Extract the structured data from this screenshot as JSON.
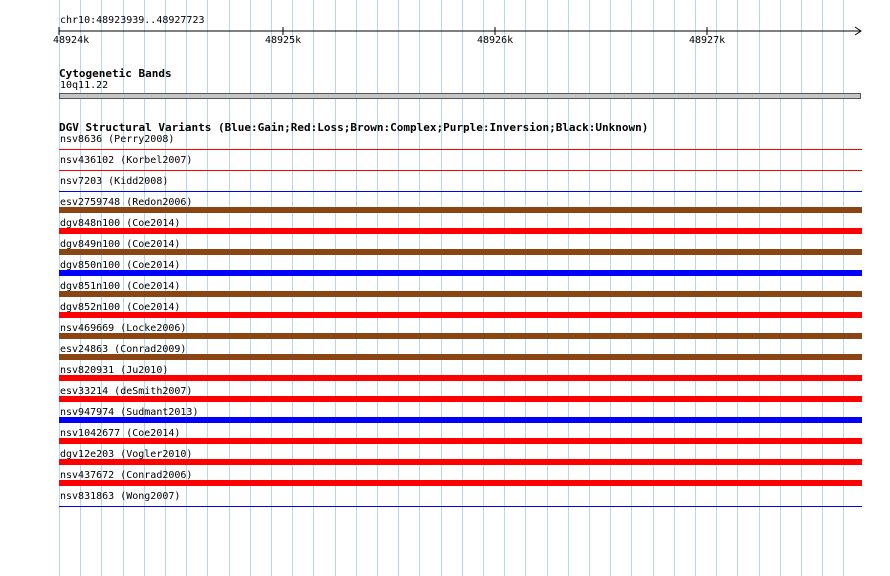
{
  "locus": "chr10:48923939..48927723",
  "ruler": {
    "ticks": [
      "48924k",
      "48925k",
      "48926k",
      "48927k"
    ]
  },
  "cytoband": {
    "title": "Cytogenetic Bands",
    "band": "10q11.22",
    "color": "#c4c4c4"
  },
  "dgv": {
    "title": "DGV Structural Variants (Blue:Gain;Red:Loss;Brown:Complex;Purple:Inversion;Black:Unknown)",
    "colors": {
      "gain": "#0000ff",
      "loss": "#ff0000",
      "complex": "#8b4513",
      "inversion": "#800080",
      "unknown": "#000000"
    },
    "items": [
      {
        "label": "nsv8636 (Perry2008)",
        "type": "loss",
        "weight": "thin"
      },
      {
        "label": "nsv436102 (Korbel2007)",
        "type": "loss",
        "weight": "thin"
      },
      {
        "label": "nsv7203 (Kidd2008)",
        "type": "gain",
        "weight": "thin"
      },
      {
        "label": "esv2759748 (Redon2006)",
        "type": "complex",
        "weight": "thick"
      },
      {
        "label": "dgv848n100 (Coe2014)",
        "type": "loss",
        "weight": "thick"
      },
      {
        "label": "dgv849n100 (Coe2014)",
        "type": "complex",
        "weight": "thick"
      },
      {
        "label": "dgv850n100 (Coe2014)",
        "type": "gain",
        "weight": "thick"
      },
      {
        "label": "dgv851n100 (Coe2014)",
        "type": "complex",
        "weight": "thick"
      },
      {
        "label": "dgv852n100 (Coe2014)",
        "type": "loss",
        "weight": "thick"
      },
      {
        "label": "nsv469669 (Locke2006)",
        "type": "complex",
        "weight": "thick"
      },
      {
        "label": "esv24863 (Conrad2009)",
        "type": "complex",
        "weight": "thick"
      },
      {
        "label": "nsv820931 (Ju2010)",
        "type": "loss",
        "weight": "thick"
      },
      {
        "label": "esv33214 (deSmith2007)",
        "type": "loss",
        "weight": "thick"
      },
      {
        "label": "nsv947974 (Sudmant2013)",
        "type": "gain",
        "weight": "thick"
      },
      {
        "label": "nsv1042677 (Coe2014)",
        "type": "loss",
        "weight": "thick"
      },
      {
        "label": "dgv12e203 (Vogler2010)",
        "type": "loss",
        "weight": "thick"
      },
      {
        "label": "nsv437672 (Conrad2006)",
        "type": "loss",
        "weight": "thick"
      },
      {
        "label": "nsv831863 (Wong2007)",
        "type": "gain",
        "weight": "thin"
      }
    ]
  }
}
